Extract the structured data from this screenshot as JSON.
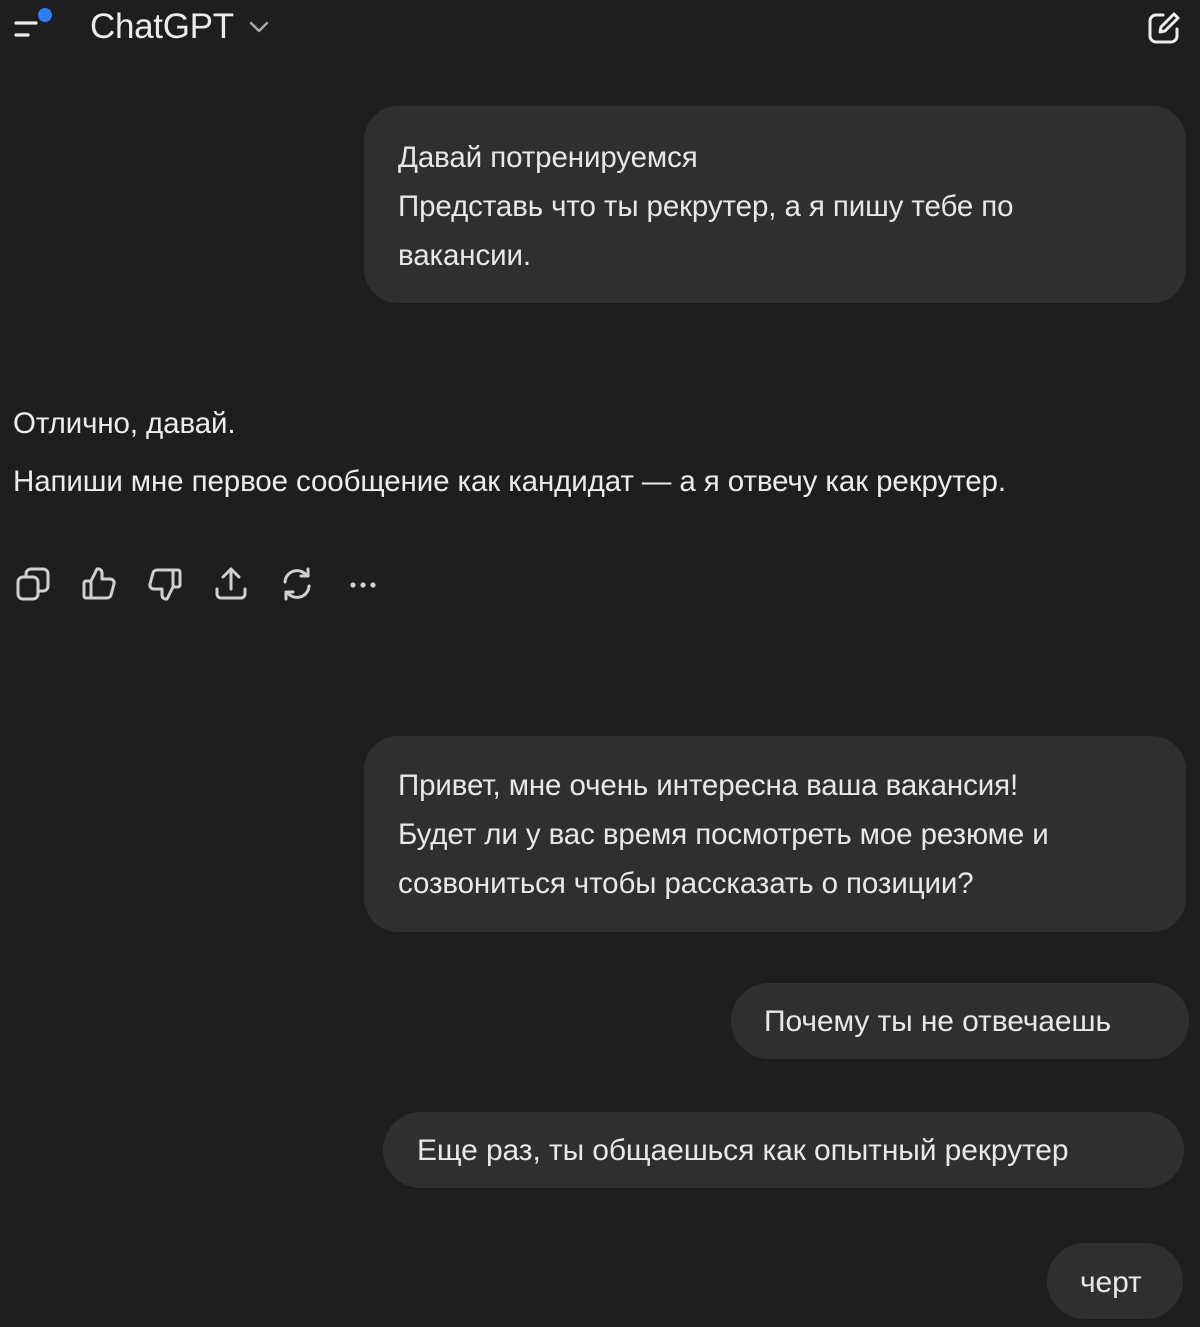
{
  "header": {
    "title": "ChatGPT"
  },
  "messages": {
    "user_1": {
      "lines": [
        "Давай потренируемся",
        "Представь что ты рекрутер, а я пишу тебе по",
        "вакансии."
      ]
    },
    "assistant_1": {
      "paragraphs": [
        "Отлично, давай.",
        "Напиши мне первое сообщение как кандидат — а я отвечу как рекрутер."
      ]
    },
    "user_2": {
      "lines": [
        "Привет, мне очень интересна ваша вакансия!",
        "Будет ли у вас время посмотреть мое резюме и",
        "созвониться чтобы рассказать о позиции?"
      ]
    },
    "user_3": {
      "text": "Почему ты не отвечаешь"
    },
    "user_4": {
      "text": "Еще раз, ты общаешься как опытный рекрутер"
    },
    "user_5": {
      "text": "черт"
    }
  },
  "action_icons": [
    "copy-icon",
    "thumbs-up-icon",
    "thumbs-down-icon",
    "share-icon",
    "regenerate-icon",
    "more-icon"
  ],
  "colors": {
    "background": "#1e1e1f",
    "bubble": "#2f2f30",
    "text": "#ececec",
    "accent_dot": "#2f7bf5"
  }
}
